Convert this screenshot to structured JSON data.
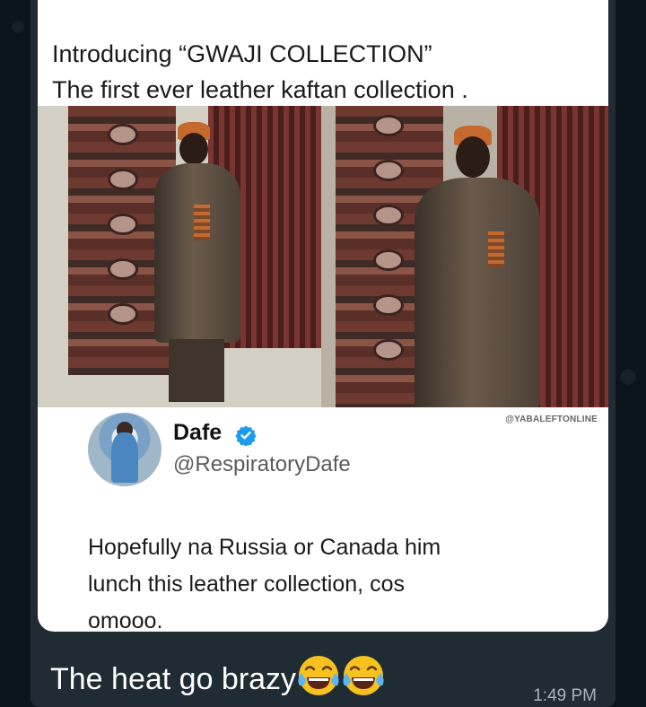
{
  "post": {
    "headline_line1": "Introducing “GWAJI COLLECTION”",
    "headline_line2": "The first ever leather kaftan collection ."
  },
  "photo": {
    "icon": "fashion-photo",
    "watermark": "@YABALEFTONLINE"
  },
  "tweet": {
    "author_name": "Dafe",
    "handle": "@RespiratoryDafe",
    "verified_icon": "verified-badge-icon",
    "text_line1": "Hopefully na Russia or Canada him",
    "text_line2": "lunch this leather collection, cos",
    "text_line3": "omooo."
  },
  "message": {
    "caption": "The heat go brazy",
    "emoji": "face-with-tears-of-joy",
    "emoji_count": 2,
    "time": "1:49 PM"
  },
  "colors": {
    "chat_bg": "#0b141a",
    "bubble_bg": "#1f2c34",
    "verified": "#1d9bf0"
  }
}
